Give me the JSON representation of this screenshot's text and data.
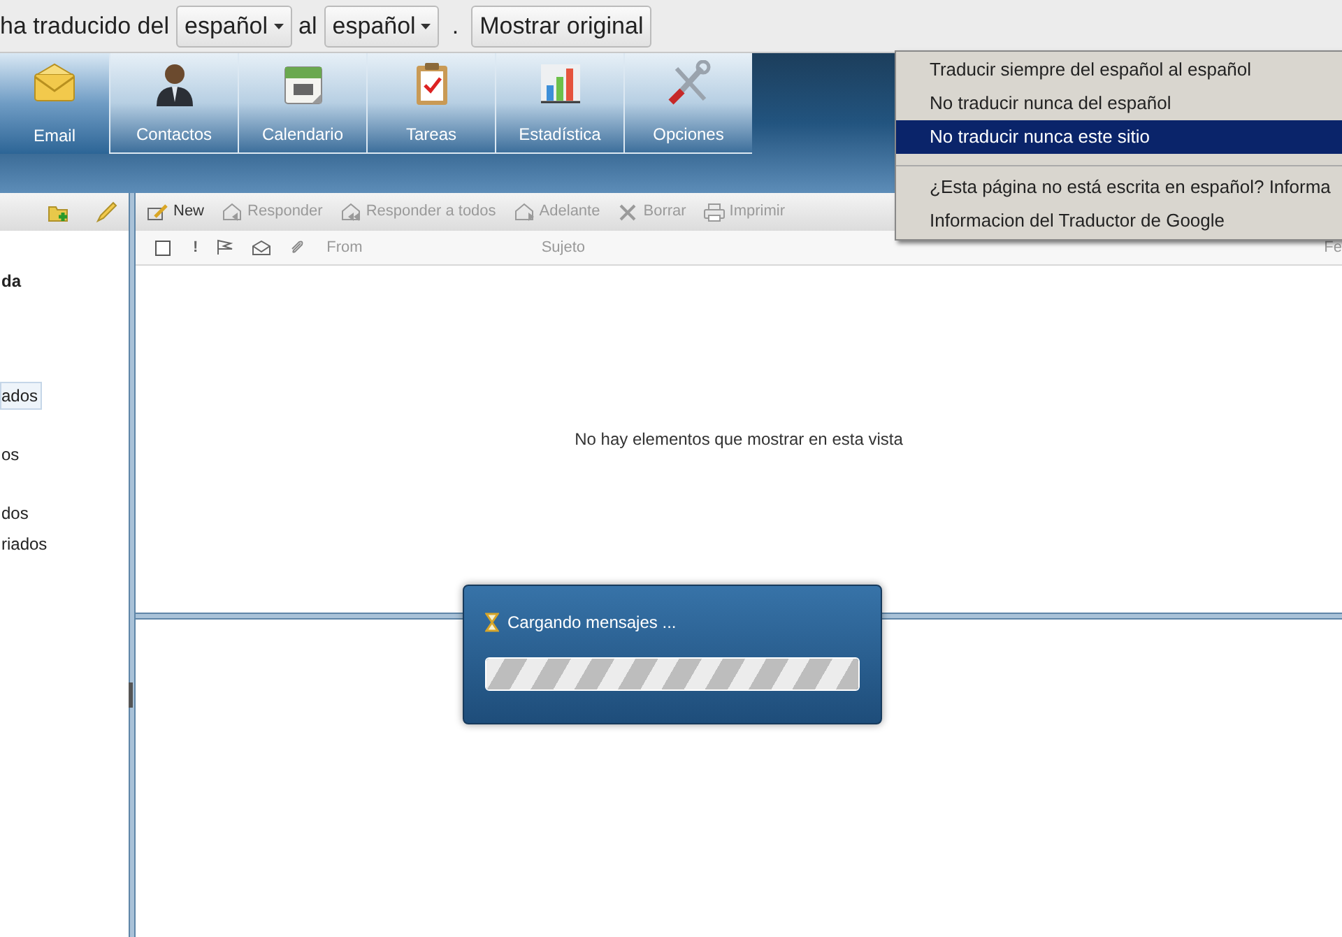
{
  "translate_bar": {
    "lead": "ha traducido del",
    "from_language": "español",
    "connector": "al",
    "to_language": "español",
    "period": ".",
    "show_original_button": "Mostrar original"
  },
  "nav_tabs": [
    {
      "label": "Email",
      "kind": "envelope",
      "selected": true
    },
    {
      "label": "Contactos",
      "kind": "person",
      "selected": false
    },
    {
      "label": "Calendario",
      "kind": "calendar",
      "selected": false
    },
    {
      "label": "Tareas",
      "kind": "clipboard",
      "selected": false
    },
    {
      "label": "Estadística",
      "kind": "chart",
      "selected": false
    },
    {
      "label": "Opciones",
      "kind": "tools",
      "selected": false
    }
  ],
  "folder_pane": {
    "items": [
      {
        "label": "da",
        "bold": true,
        "selected": false
      },
      {
        "label": "ados",
        "bold": false,
        "selected": true
      },
      {
        "label": "os",
        "bold": false,
        "selected": false
      },
      {
        "label": "dos",
        "bold": false,
        "selected": false
      },
      {
        "label": "riados",
        "bold": false,
        "selected": false
      }
    ]
  },
  "mail_toolbar": [
    {
      "label": "New",
      "kind": "compose",
      "disabled": false
    },
    {
      "label": "Responder",
      "kind": "reply",
      "disabled": true
    },
    {
      "label": "Responder a todos",
      "kind": "replyall",
      "disabled": true
    },
    {
      "label": "Adelante",
      "kind": "forward",
      "disabled": true
    },
    {
      "label": "Borrar",
      "kind": "delete",
      "disabled": true
    },
    {
      "label": "Imprimir",
      "kind": "print",
      "disabled": true
    }
  ],
  "message_columns": {
    "select_all_checked": false,
    "importance": "!",
    "from": "From",
    "subject": "Sujeto",
    "column_8": "Fe"
  },
  "empty_message": "No hay elementos que mostrar en esta vista",
  "loading_dialog": {
    "title": "Cargando mensajes ...",
    "level": 1
  },
  "translate_menu": [
    {
      "label": "Traducir siempre del español al español",
      "selected": false,
      "divider_before": false
    },
    {
      "label": "No traducir nunca del español",
      "selected": false,
      "divider_before": false
    },
    {
      "label": "No traducir nunca este sitio",
      "selected": true,
      "divider_before": false
    },
    {
      "label": "¿Esta página no está escrita en español? Informa",
      "selected": false,
      "divider_before": true
    },
    {
      "label": "Informacion del Traductor de Google",
      "selected": false,
      "divider_before": false
    }
  ]
}
